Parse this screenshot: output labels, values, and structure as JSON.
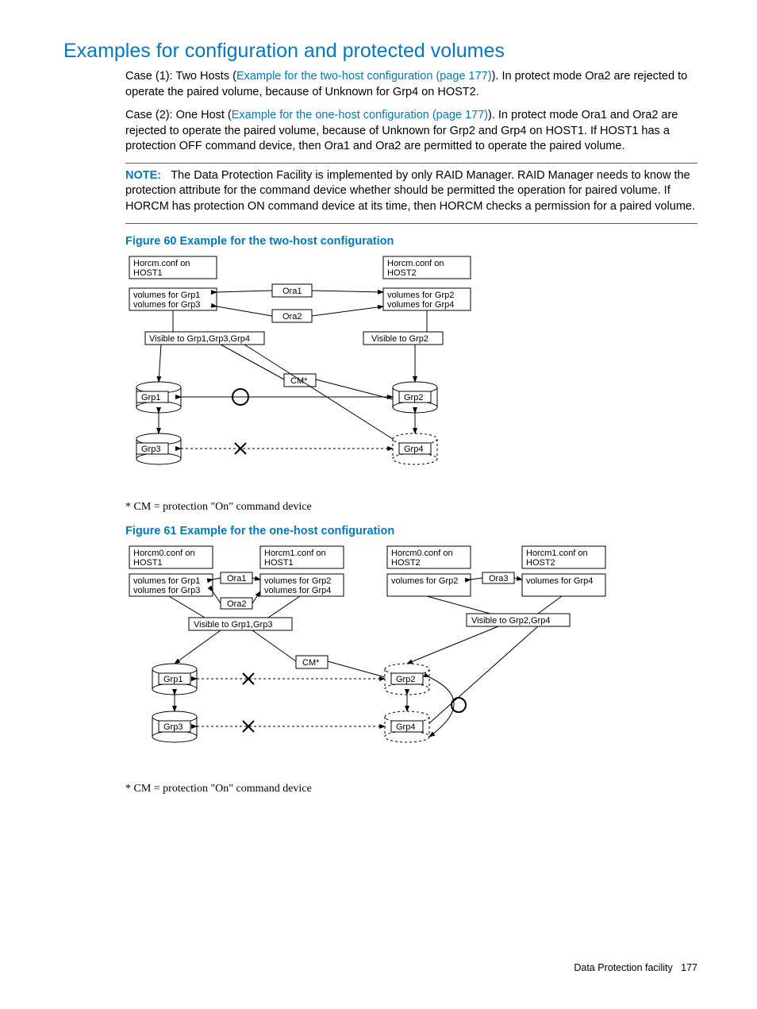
{
  "title": "Examples for configuration and protected volumes",
  "para1_a": "Case (1): Two Hosts (",
  "para1_link": "Example for the two-host configuration (page 177)",
  "para1_b": "). In protect mode Ora2 are rejected to operate the paired volume, because of Unknown for Grp4 on HOST2.",
  "para2_a": "Case (2): One Host (",
  "para2_link": "Example for the one-host configuration (page 177)",
  "para2_b": "). In protect mode Ora1 and Ora2 are rejected to operate the paired volume, because of Unknown for Grp2 and Grp4 on HOST1. If HOST1 has a protection OFF command device, then Ora1 and Ora2 are permitted to operate the paired volume.",
  "note_label": "NOTE:",
  "note_text": "The Data Protection Facility is implemented by only RAID Manager. RAID Manager needs to know the protection attribute for the command device whether should be permitted the operation for paired volume. If HORCM has protection ON command device at its time, then HORCM checks a permission for a paired volume.",
  "fig60_cap": "Figure 60 Example for the two-host configuration",
  "fig61_cap": "Figure 61 Example for the one-host configuration",
  "footnote": "* CM = protection \"On\" command device",
  "footer_text": "Data Protection facility",
  "footer_page": "177",
  "svg60": {
    "h1a": "Horcm.conf on",
    "h1b": "HOST1",
    "h2a": "Horcm.conf on",
    "h2b": "HOST2",
    "v1": "volumes for Grp1",
    "v2": "volumes for Grp2",
    "v3": "volumes for Grp3",
    "v4": "volumes for Grp4",
    "ora1": "Ora1",
    "ora2": "Ora2",
    "vis1": "Visible to Grp1,Grp3,Grp4",
    "vis2": "Visible to Grp2",
    "cm": "CM*",
    "g1": "Grp1",
    "g2": "Grp2",
    "g3": "Grp3",
    "g4": "Grp4"
  },
  "svg61": {
    "h1a": "Horcm0.conf on",
    "h1b": "HOST1",
    "h2a": "Horcm1.conf on",
    "h2b": "HOST1",
    "h3a": "Horcm0.conf on",
    "h3b": "HOST2",
    "h4a": "Horcm1.conf on",
    "h4b": "HOST2",
    "v1": "volumes for Grp1",
    "v2": "volumes for Grp2",
    "v3": "volumes for Grp3",
    "v4": "volumes for Grp4",
    "v2b": "volumes for Grp2",
    "v4b": "volumes for Grp4",
    "ora1": "Ora1",
    "ora2": "Ora2",
    "ora3": "Ora3",
    "vis1": "Visible to Grp1,Grp3",
    "vis2": "Visible to Grp2,Grp4",
    "cm": "CM*",
    "g1": "Grp1",
    "g2": "Grp2",
    "g3": "Grp3",
    "g4": "Grp4"
  }
}
